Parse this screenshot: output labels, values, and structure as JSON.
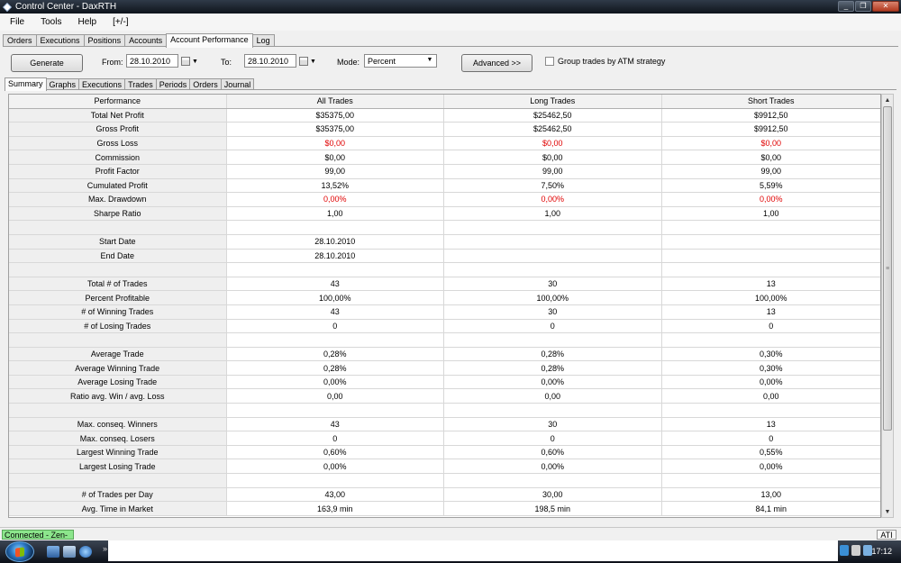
{
  "window": {
    "title": "Control Center - DaxRTH",
    "minimize": "_",
    "restore": "❐",
    "close": "✕"
  },
  "menu": [
    "File",
    "Tools",
    "Help",
    "[+/-]"
  ],
  "main_tabs": [
    "Orders",
    "Executions",
    "Positions",
    "Accounts",
    "Account Performance",
    "Log"
  ],
  "main_tab_active": "Account Performance",
  "toolbar": {
    "generate_label": "Generate",
    "from_label": "From:",
    "from_value": "28.10.2010",
    "to_label": "To:",
    "to_value": "28.10.2010",
    "mode_label": "Mode:",
    "mode_value": "Percent",
    "advanced_label": "Advanced >>",
    "group_label": "Group trades by ATM strategy",
    "group_checked": false
  },
  "sub_tabs": [
    "Summary",
    "Graphs",
    "Executions",
    "Trades",
    "Periods",
    "Orders",
    "Journal"
  ],
  "sub_tab_active": "Summary",
  "table": {
    "headers": [
      "Performance",
      "All Trades",
      "Long Trades",
      "Short Trades"
    ],
    "rows": [
      {
        "label": "Total Net Profit",
        "all": "$35375,00",
        "long": "$25462,50",
        "short": "$9912,50",
        "neg": false
      },
      {
        "label": "Gross Profit",
        "all": "$35375,00",
        "long": "$25462,50",
        "short": "$9912,50",
        "neg": false
      },
      {
        "label": "Gross Loss",
        "all": "$0,00",
        "long": "$0,00",
        "short": "$0,00",
        "neg": true
      },
      {
        "label": "Commission",
        "all": "$0,00",
        "long": "$0,00",
        "short": "$0,00",
        "neg": false
      },
      {
        "label": "Profit Factor",
        "all": "99,00",
        "long": "99,00",
        "short": "99,00",
        "neg": false
      },
      {
        "label": "Cumulated Profit",
        "all": "13,52%",
        "long": "7,50%",
        "short": "5,59%",
        "neg": false
      },
      {
        "label": "Max. Drawdown",
        "all": "0,00%",
        "long": "0,00%",
        "short": "0,00%",
        "neg": true
      },
      {
        "label": "Sharpe Ratio",
        "all": "1,00",
        "long": "1,00",
        "short": "1,00",
        "neg": false
      },
      {
        "label": "",
        "all": "",
        "long": "",
        "short": "",
        "neg": false
      },
      {
        "label": "Start Date",
        "all": "28.10.2010",
        "long": "",
        "short": "",
        "neg": false
      },
      {
        "label": "End Date",
        "all": "28.10.2010",
        "long": "",
        "short": "",
        "neg": false
      },
      {
        "label": "",
        "all": "",
        "long": "",
        "short": "",
        "neg": false
      },
      {
        "label": "Total # of Trades",
        "all": "43",
        "long": "30",
        "short": "13",
        "neg": false
      },
      {
        "label": "Percent Profitable",
        "all": "100,00%",
        "long": "100,00%",
        "short": "100,00%",
        "neg": false
      },
      {
        "label": "# of Winning Trades",
        "all": "43",
        "long": "30",
        "short": "13",
        "neg": false
      },
      {
        "label": "# of Losing Trades",
        "all": "0",
        "long": "0",
        "short": "0",
        "neg": false
      },
      {
        "label": "",
        "all": "",
        "long": "",
        "short": "",
        "neg": false
      },
      {
        "label": "Average Trade",
        "all": "0,28%",
        "long": "0,28%",
        "short": "0,30%",
        "neg": false
      },
      {
        "label": "Average Winning Trade",
        "all": "0,28%",
        "long": "0,28%",
        "short": "0,30%",
        "neg": false
      },
      {
        "label": "Average Losing Trade",
        "all": "0,00%",
        "long": "0,00%",
        "short": "0,00%",
        "neg": false
      },
      {
        "label": "Ratio avg. Win / avg. Loss",
        "all": "0,00",
        "long": "0,00",
        "short": "0,00",
        "neg": false
      },
      {
        "label": "",
        "all": "",
        "long": "",
        "short": "",
        "neg": false
      },
      {
        "label": "Max. conseq. Winners",
        "all": "43",
        "long": "30",
        "short": "13",
        "neg": false
      },
      {
        "label": "Max. conseq. Losers",
        "all": "0",
        "long": "0",
        "short": "0",
        "neg": false
      },
      {
        "label": "Largest Winning Trade",
        "all": "0,60%",
        "long": "0,60%",
        "short": "0,55%",
        "neg": false
      },
      {
        "label": "Largest Losing Trade",
        "all": "0,00%",
        "long": "0,00%",
        "short": "0,00%",
        "neg": false
      },
      {
        "label": "",
        "all": "",
        "long": "",
        "short": "",
        "neg": false
      },
      {
        "label": "# of Trades per Day",
        "all": "43,00",
        "long": "30,00",
        "short": "13,00",
        "neg": false
      },
      {
        "label": "Avg. Time in Market",
        "all": "163,9 min",
        "long": "198,5 min",
        "short": "84,1 min",
        "neg": false
      }
    ]
  },
  "status": {
    "connection": "Connected - Zen-Fire",
    "right_label": "ATI"
  },
  "taskbar": {
    "overflow": "»",
    "time": "17:12"
  },
  "colors": {
    "negative": "#e00000",
    "connected_bg": "#8ce68c"
  }
}
